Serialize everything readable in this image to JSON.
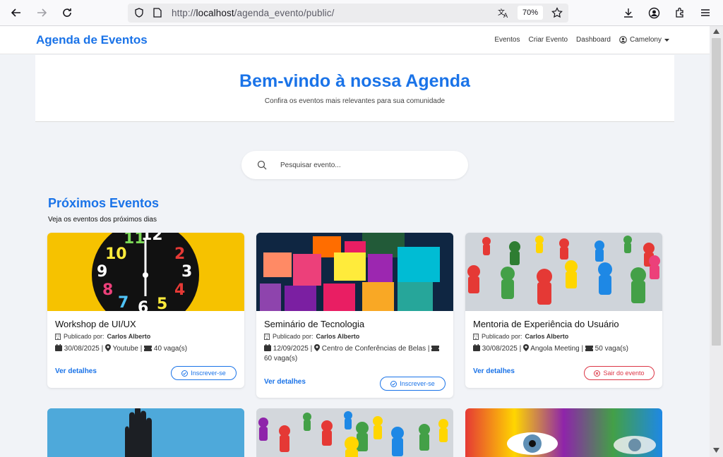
{
  "browser": {
    "url_prefix": "http://",
    "url_host": "localhost",
    "url_path": "/agenda_evento/public/",
    "zoom": "70%"
  },
  "navbar": {
    "brand": "Agenda de Eventos",
    "links": [
      "Eventos",
      "Criar Evento",
      "Dashboard"
    ],
    "user": "Camelony"
  },
  "hero": {
    "title": "Bem-vindo à nossa Agenda",
    "subtitle": "Confira os eventos mais relevantes para sua comunidade"
  },
  "search": {
    "placeholder": "Pesquisar evento..."
  },
  "section": {
    "title": "Próximos Eventos",
    "subtitle": "Veja os eventos dos próximos dias"
  },
  "events": [
    {
      "title": "Workshop de UI/UX",
      "published_label": "Publicado por:",
      "author": "Carlos Alberto",
      "date": "30/08/2025",
      "location": "Youtube",
      "slots": "40 vaga(s)",
      "details": "Ver detalhes",
      "action": "Inscrever-se"
    },
    {
      "title": "Seminário de Tecnologia",
      "published_label": "Publicado por:",
      "author": "Carlos Alberto",
      "date": "12/09/2025",
      "location": "Centro de Conferências de Belas",
      "slots": "60 vaga(s)",
      "details": "Ver detalhes",
      "action": "Inscrever-se"
    },
    {
      "title": "Mentoria de Experiência do Usuário",
      "published_label": "Publicado por:",
      "author": "Carlos Alberto",
      "date": "30/08/2025",
      "location": "Angola Meeting",
      "slots": "50 vaga(s)",
      "details": "Ver detalhes",
      "action": "Sair do evento"
    }
  ],
  "colors": {
    "primary": "#1a73e8",
    "danger": "#dc3545"
  }
}
